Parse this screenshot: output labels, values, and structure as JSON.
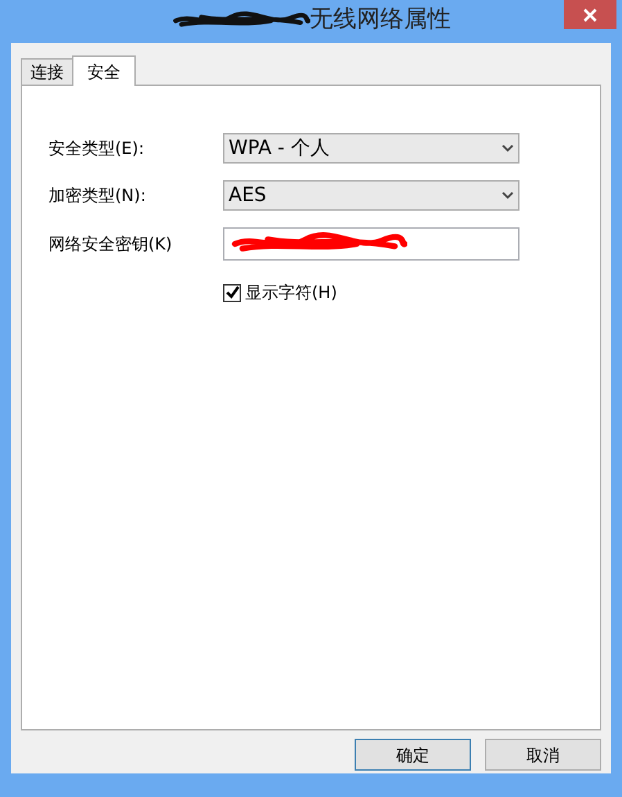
{
  "window": {
    "title": "无线网络属性",
    "title_redacted": true
  },
  "tabs": [
    {
      "label": "连接",
      "selected": false
    },
    {
      "label": "安全",
      "selected": true
    }
  ],
  "fields": [
    {
      "kind": "select",
      "label": "安全类型(E):",
      "value": "WPA - 个人"
    },
    {
      "kind": "select",
      "label": "加密类型(N):",
      "value": "AES"
    },
    {
      "kind": "password",
      "label": "网络安全密钥(K)",
      "redacted": true
    }
  ],
  "show_characters": {
    "label": "显示字符(H)",
    "checked": true
  },
  "buttons": [
    "确定",
    "取消"
  ]
}
